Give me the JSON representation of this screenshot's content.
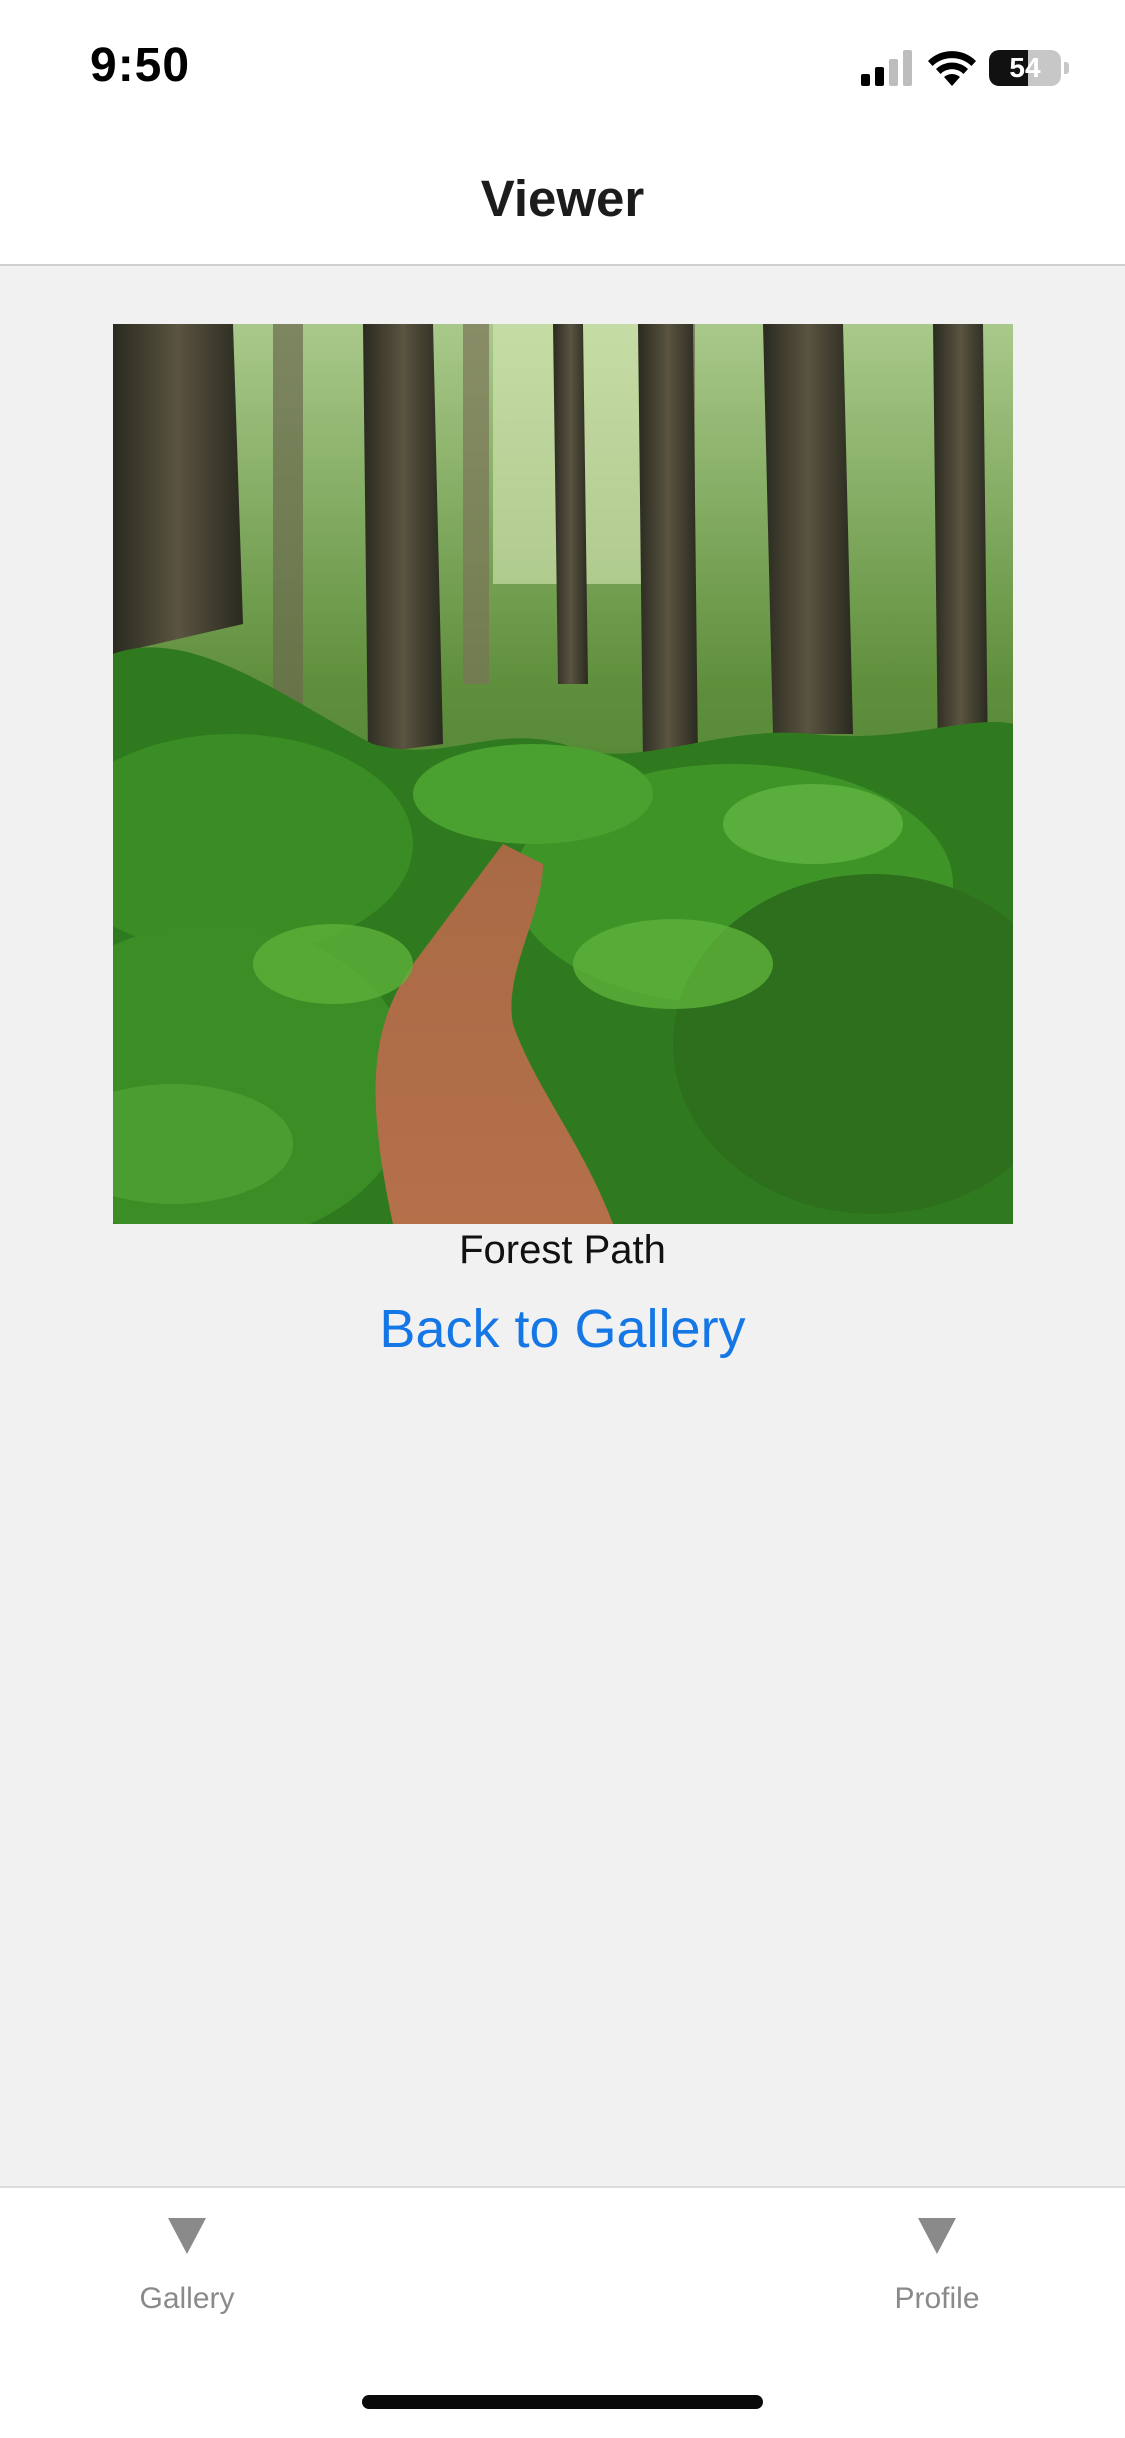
{
  "status_bar": {
    "time": "9:50",
    "battery_level": "54",
    "battery_fraction": 0.54,
    "signal_bars_active": 2,
    "signal_bars_total": 4,
    "icons": [
      "cellular-signal-icon",
      "wifi-icon",
      "battery-icon"
    ]
  },
  "nav": {
    "title": "Viewer"
  },
  "viewer": {
    "image_icon": "photo-forest-path",
    "caption": "Forest Path",
    "back_label": "Back to Gallery"
  },
  "tab_bar": {
    "tabs": [
      {
        "label": "Gallery",
        "icon": "triangle-down-icon"
      },
      {
        "label": "Profile",
        "icon": "triangle-down-icon"
      }
    ]
  },
  "colors": {
    "accent": "#1577e6",
    "background": "#f1f1f1",
    "bar_background": "#ffffff",
    "tab_inactive": "#8a8a8a"
  }
}
